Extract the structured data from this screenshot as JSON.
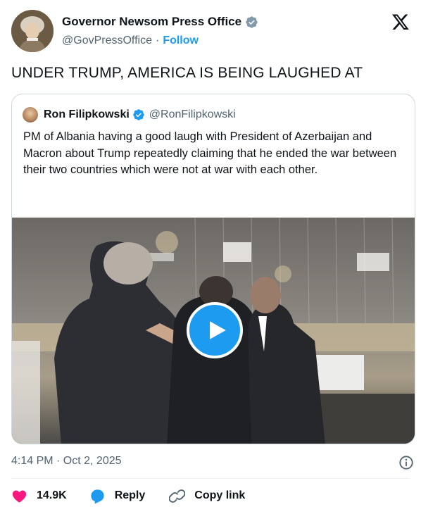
{
  "author": {
    "display_name": "Governor Newsom Press Office",
    "handle": "@GovPressOffice",
    "separator": "·",
    "follow_label": "Follow",
    "verified_icon": "verified-badge-icon",
    "verified_color": "#829aab"
  },
  "platform_logo": "x-logo-icon",
  "tweet": {
    "text": "UNDER TRUMP, AMERICA IS BEING LAUGHED AT"
  },
  "quoted_tweet": {
    "display_name": "Ron Filipkowski",
    "handle": "@RonFilipkowski",
    "verified_color": "#1d9bf0",
    "text": "PM of Albania having a good laugh with President of Azerbaijan and Macron about Trump repeatedly claiming that he ended the war between their two countries which were not at war with each other.",
    "media": {
      "type": "video",
      "play_icon": "play-icon"
    }
  },
  "meta": {
    "timestamp": "4:14 PM · Oct 2, 2025",
    "info_icon": "info-icon"
  },
  "actions": {
    "like_count": "14.9K",
    "reply_label": "Reply",
    "copy_label": "Copy link",
    "accent_like": "#f91880",
    "accent_reply": "#1d9bf0"
  }
}
